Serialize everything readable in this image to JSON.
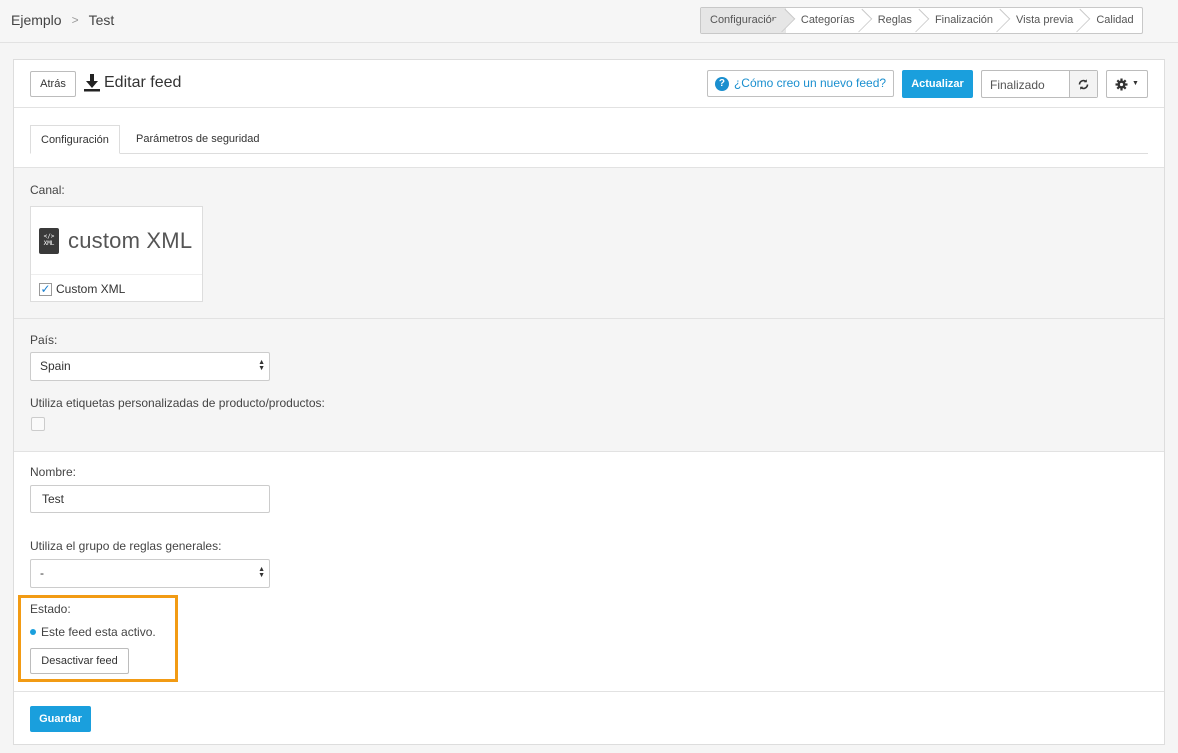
{
  "breadcrumb": {
    "parent": "Ejemplo",
    "separator": ">",
    "current": "Test"
  },
  "steps": [
    "Configuración",
    "Categorías",
    "Reglas",
    "Finalización",
    "Vista previa",
    "Calidad"
  ],
  "header": {
    "back_label": "Atrás",
    "title": "Editar feed",
    "help_label": "¿Cómo creo un nuevo feed?",
    "update_label": "Actualizar",
    "status_value": "Finalizado"
  },
  "tabs": [
    "Configuración",
    "Parámetros de seguridad"
  ],
  "canal": {
    "label": "Canal:",
    "logo_text": "custom XML",
    "file_tag": "XML",
    "option_label": "Custom XML",
    "checked": true
  },
  "pais": {
    "label": "País:",
    "value": "Spain"
  },
  "custom_labels": {
    "label": "Utiliza etiquetas personalizadas de producto/productos:"
  },
  "nombre": {
    "label": "Nombre:",
    "value": "Test"
  },
  "reglas": {
    "label": "Utiliza el grupo de reglas generales:",
    "value": "-"
  },
  "estado": {
    "label": "Estado:",
    "text": "Este feed esta activo.",
    "button": "Desactivar feed"
  },
  "footer": {
    "save_label": "Guardar"
  },
  "colors": {
    "primary": "#1a9fdd",
    "highlight": "#f29b14"
  }
}
